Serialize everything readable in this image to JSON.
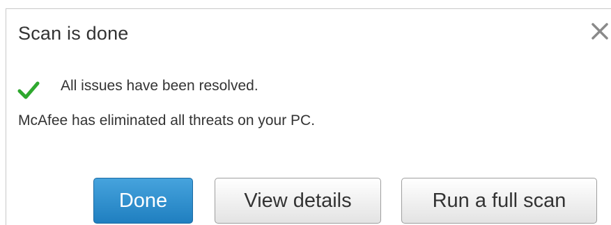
{
  "dialog": {
    "title": "Scan is done",
    "close_icon": "close-icon",
    "status_icon": "checkmark-icon",
    "status_icon_color": "#2ea82e",
    "status_text": "All issues have been resolved.",
    "description": "McAfee has eliminated all threats on your PC.",
    "buttons": {
      "done": "Done",
      "view_details": "View details",
      "run_full_scan": "Run a full scan"
    }
  },
  "colors": {
    "primary_button": "#2b8fd0",
    "text": "#333333"
  }
}
